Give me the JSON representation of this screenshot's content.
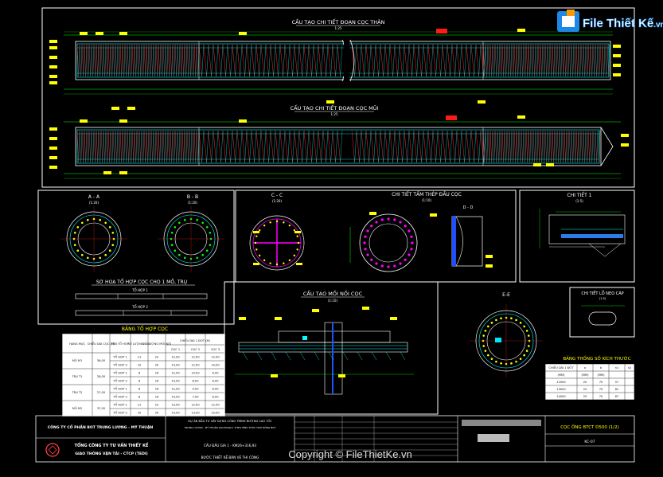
{
  "watermark": {
    "brand": "File Thiết Kế",
    "domain": ".vn",
    "copyright": "Copyright © FileThietKe.vn"
  },
  "colors": {
    "background": "#000000",
    "rebar": "#00ffff",
    "spiral": "#ff2a2a",
    "tag": "#ffff00",
    "dim": "#00ff00",
    "brand": "#1e88e5"
  },
  "titles": {
    "pile_body": "CẤU TẠO CHI TIẾT ĐOẠN CỌC THÂN",
    "pile_tip": "CẤU TẠO CHI TIẾT ĐOẠN CỌC MŨI",
    "scale_25": "1:25",
    "sec_aa": "A - A",
    "sec_bb": "B - B",
    "sec_cc": "C - C",
    "sec_dd": "D - D",
    "sec_ee": "E-E",
    "scale_20": "(1:20)",
    "scale_10": "(1:10)",
    "scale_5": "(1:5)",
    "head_plate": "CHI TIẾT TẤM THÉP ĐẦU CỌC",
    "detail_1": "CHI TIẾT 1",
    "splice": "CẤU TẠO MỐI NỐI CỌC",
    "anchor_hole": "CHI TIẾT LỖ NEO CÁP",
    "combo_diagram": "SƠ HOẠ TỔ HỢP CỌC CHO 1 MỐ, TRỤ",
    "combo_1": "TỔ HỢP 1",
    "combo_2": "TỔ HỢP 2",
    "combo_table": "BẢNG TỔ HỢP CỌC",
    "dim_table": "BẢNG THỐNG SỐ KÍCH THƯỚC"
  },
  "combo_table": {
    "headers": [
      "HẠNG MỤC",
      "CHIỀU DÀI CỌC (M)",
      "TÊN TỔ HỢP",
      "SỐ LƯỢNG CỌC",
      "SỐ LƯỢNG MỐI NỐI",
      "CỌC 1",
      "CỌC 2",
      "CỌC 3"
    ],
    "group_header": "CHIỀU DÀI 1 ĐỐT (M)",
    "rows": [
      [
        "MỐ M1",
        "36,00",
        "TỔ HỢP 1",
        "11",
        "22",
        "12,00",
        "12,00",
        "12,00"
      ],
      [
        "",
        "",
        "TỔ HỢP 2",
        "10",
        "20",
        "14,00",
        "12,00",
        "10,00"
      ],
      [
        "TRỤ T1",
        "28,00",
        "TỔ HỢP 1",
        "8",
        "16",
        "12,00",
        "10,00",
        "6,00"
      ],
      [
        "",
        "",
        "TỔ HỢP 2",
        "8",
        "16",
        "14,00",
        "8,00",
        "6,00"
      ],
      [
        "TRỤ T2",
        "27,00",
        "TỔ HỢP 1",
        "8",
        "16",
        "12,00",
        "9,00",
        "6,00"
      ],
      [
        "",
        "",
        "TỔ HỢP 2",
        "8",
        "16",
        "14,00",
        "7,00",
        "6,00"
      ],
      [
        "MỐ M2",
        "37,00",
        "TỔ HỢP 1",
        "11",
        "22",
        "13,00",
        "12,00",
        "12,00"
      ],
      [
        "",
        "",
        "TỔ HỢP 2",
        "10",
        "20",
        "14,00",
        "13,00",
        "10,00"
      ]
    ]
  },
  "dim_table": {
    "headers": [
      "CHIỀU DÀI 1 ĐỐT",
      "a",
      "b",
      "n1",
      "n2"
    ],
    "units": [
      "(MM)",
      "(MM)",
      "(MM)",
      "",
      ""
    ],
    "rows": [
      [
        "12000",
        "20",
        "70",
        "57",
        ""
      ],
      [
        "13000",
        "25",
        "70",
        "62",
        ""
      ],
      [
        "14000",
        "25",
        "70",
        "67",
        ""
      ]
    ]
  },
  "title_block": {
    "company": "CÔNG TY CỔ PHẦN BOT TRUNG LƯƠNG - MỸ THUẬN",
    "consultant_1": "TỔNG CÔNG TY TƯ VẤN THIẾT KẾ",
    "consultant_2": "GIAO THÔNG VẬN TẢI - CTCP (TEDI)",
    "project_1": "DỰ ÁN ĐẦU TƯ XÂY DỰNG CÔNG TRÌNH ĐƯỜNG CAO TỐC",
    "project_2": "TRUNG LƯƠNG - MỸ THUẬN GIAI ĐOẠN 1 THEO HÌNH THỨC HỢP ĐỒNG BOT",
    "package": "CẦU ĐẦU GIA 1 - KM26+316,93",
    "stage": "BƯỚC THIẾT KẾ BẢN VẼ THI CÔNG",
    "drawing": "CỌC ỐNG BTCT D500 (1/2)",
    "code": "KC-07"
  },
  "dims": {
    "d_400": "400",
    "d_300": "300",
    "d_500": "Ø 500",
    "d_150": "150",
    "d_480": "Ø 480"
  }
}
